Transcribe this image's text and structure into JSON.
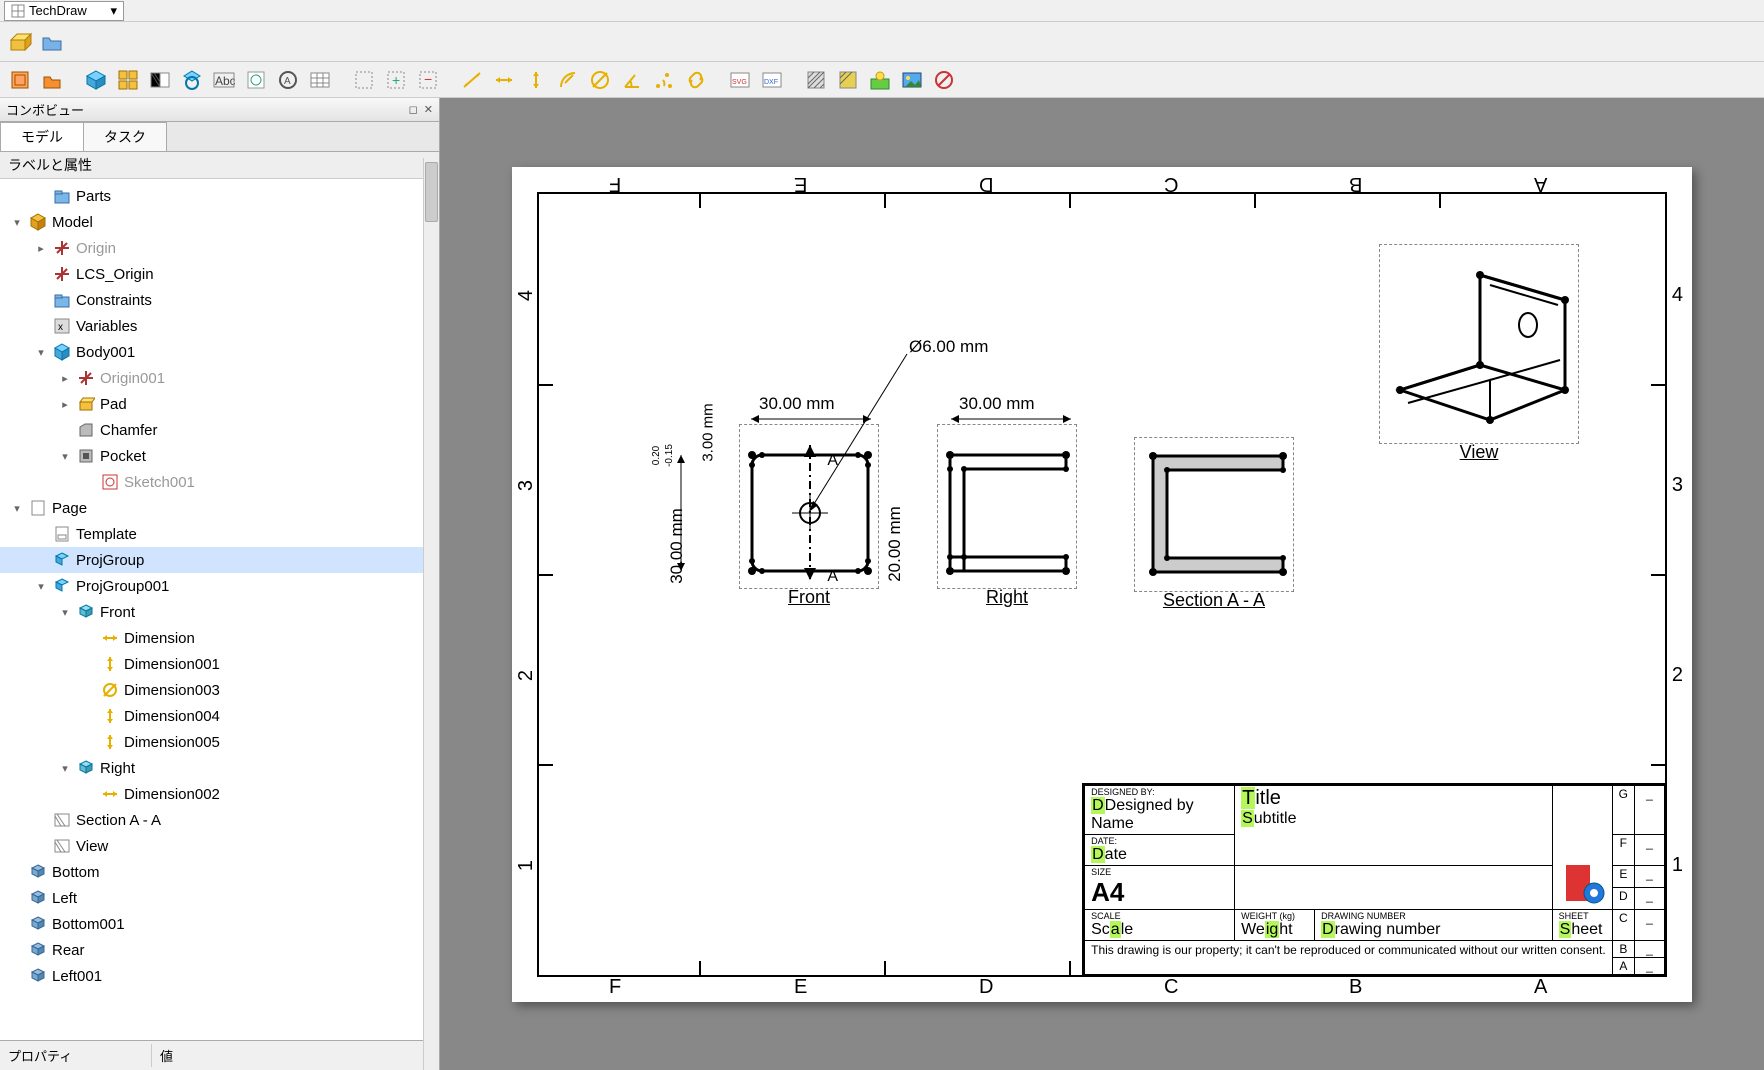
{
  "workbench": {
    "name": "TechDraw"
  },
  "combo": {
    "title": "コンボビュー",
    "tab_model": "モデル",
    "tab_task": "タスク",
    "tree_header": "ラベルと属性",
    "prop_label": "プロパティ",
    "prop_value": "値"
  },
  "tree": [
    {
      "d": 1,
      "exp": "",
      "ic": "folder",
      "label": "Parts"
    },
    {
      "d": 0,
      "exp": "▾",
      "ic": "model",
      "label": "Model"
    },
    {
      "d": 1,
      "exp": "▸",
      "ic": "origin",
      "label": "Origin",
      "gray": true
    },
    {
      "d": 1,
      "exp": "",
      "ic": "origin",
      "label": "LCS_Origin"
    },
    {
      "d": 1,
      "exp": "",
      "ic": "folder",
      "label": "Constraints"
    },
    {
      "d": 1,
      "exp": "",
      "ic": "vars",
      "label": "Variables"
    },
    {
      "d": 1,
      "exp": "▾",
      "ic": "body",
      "label": "Body001"
    },
    {
      "d": 2,
      "exp": "▸",
      "ic": "origin",
      "label": "Origin001",
      "gray": true
    },
    {
      "d": 2,
      "exp": "▸",
      "ic": "pad",
      "label": "Pad"
    },
    {
      "d": 2,
      "exp": "",
      "ic": "chamfer",
      "label": "Chamfer"
    },
    {
      "d": 2,
      "exp": "▾",
      "ic": "pocket",
      "label": "Pocket"
    },
    {
      "d": 3,
      "exp": "",
      "ic": "sketch",
      "label": "Sketch001",
      "gray": true
    },
    {
      "d": 0,
      "exp": "▾",
      "ic": "page",
      "label": "Page"
    },
    {
      "d": 1,
      "exp": "",
      "ic": "template",
      "label": "Template"
    },
    {
      "d": 1,
      "exp": "",
      "ic": "projgrp",
      "label": "ProjGroup",
      "sel": true
    },
    {
      "d": 1,
      "exp": "▾",
      "ic": "projgrp",
      "label": "ProjGroup001"
    },
    {
      "d": 2,
      "exp": "▾",
      "ic": "view3d",
      "label": "Front"
    },
    {
      "d": 3,
      "exp": "",
      "ic": "dimh",
      "label": "Dimension"
    },
    {
      "d": 3,
      "exp": "",
      "ic": "dimv",
      "label": "Dimension001"
    },
    {
      "d": 3,
      "exp": "",
      "ic": "dimd",
      "label": "Dimension003"
    },
    {
      "d": 3,
      "exp": "",
      "ic": "dimv",
      "label": "Dimension004"
    },
    {
      "d": 3,
      "exp": "",
      "ic": "dimv",
      "label": "Dimension005"
    },
    {
      "d": 2,
      "exp": "▾",
      "ic": "view3d",
      "label": "Right"
    },
    {
      "d": 3,
      "exp": "",
      "ic": "dimh",
      "label": "Dimension002"
    },
    {
      "d": 1,
      "exp": "",
      "ic": "section",
      "label": "Section A - A"
    },
    {
      "d": 1,
      "exp": "",
      "ic": "section",
      "label": "View"
    },
    {
      "d": 0,
      "exp": "",
      "ic": "block",
      "label": "Bottom"
    },
    {
      "d": 0,
      "exp": "",
      "ic": "block",
      "label": "Left"
    },
    {
      "d": 0,
      "exp": "",
      "ic": "block",
      "label": "Bottom001"
    },
    {
      "d": 0,
      "exp": "",
      "ic": "block",
      "label": "Rear"
    },
    {
      "d": 0,
      "exp": "",
      "ic": "block",
      "label": "Left001"
    }
  ],
  "drawing": {
    "columns_top": [
      "F",
      "E",
      "D",
      "C",
      "B",
      "A"
    ],
    "columns_bot": [
      "F",
      "E",
      "D",
      "C",
      "B",
      "A"
    ],
    "rows": [
      "4",
      "3",
      "2",
      "1"
    ],
    "views": {
      "front": {
        "label": "Front"
      },
      "right": {
        "label": "Right"
      },
      "section": {
        "label": "Section A - A"
      },
      "iso": {
        "label": "View"
      }
    },
    "dims": {
      "d_h_top": "30.00 mm",
      "d_v_left": "30.00 mm",
      "d_v_small": "3.00 mm",
      "d_tol_up": "0.20",
      "d_tol_dn": "-0.15",
      "d_right_top": "30.00 mm",
      "d_right_side": "20.00 mm",
      "diam": "Ø6.00 mm",
      "secA_top": "A",
      "secA_bot": "A"
    }
  },
  "titleblock": {
    "designed_by_lbl": "DESIGNED BY:",
    "designed_by": "Designed by Name",
    "date_lbl": "DATE:",
    "date": "Date",
    "title_lbl": "Title",
    "subtitle_lbl": "Subtitle",
    "size_lbl": "SIZE",
    "size": "A4",
    "scale_lbl": "SCALE",
    "scale": "Scale",
    "weight_lbl": "WEIGHT (kg)",
    "weight": "Weight",
    "drawnum_lbl": "DRAWING NUMBER",
    "drawnum": "Drawing number",
    "sheet_lbl": "SHEET",
    "sheet": "Sheet",
    "note": "This drawing is our property; it can't be reproduced or communicated without our written consent.",
    "rev_lbls": [
      "G",
      "F",
      "E",
      "D",
      "C",
      "B",
      "A"
    ],
    "rev_dash": "_"
  }
}
